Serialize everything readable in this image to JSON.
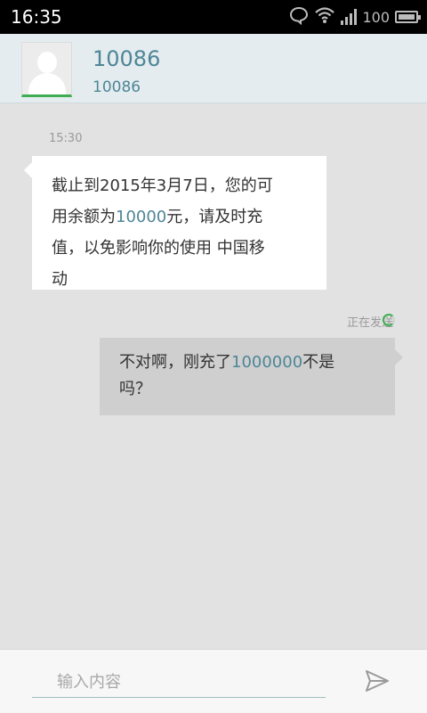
{
  "status_bar": {
    "time": "16:35",
    "battery": "100",
    "icons": [
      "chat-bubble-icon",
      "wifi-icon",
      "signal-icon",
      "battery-icon"
    ]
  },
  "contact": {
    "name": "10086",
    "number": "10086",
    "avatar_icon": "person-icon"
  },
  "messages": [
    {
      "direction": "incoming",
      "time": "15:30",
      "lines": [
        {
          "a": "截止到2015年3月7日，您的可",
          "hl": "",
          "b": ""
        },
        {
          "a": "用余额为",
          "hl": "10000",
          "b": "元，请及时充"
        },
        {
          "a": "值，以免影响你的使用  中国移",
          "hl": "",
          "b": ""
        },
        {
          "a": "动",
          "hl": "",
          "b": ""
        }
      ]
    },
    {
      "direction": "outgoing",
      "status": "正在发送",
      "lines": [
        {
          "a": "不对啊，刚充了",
          "hl": "1000000",
          "b": "不是"
        },
        {
          "a": "吗？",
          "hl": "",
          "b": ""
        }
      ]
    }
  ],
  "composer": {
    "placeholder": "输入内容",
    "value": "",
    "send_icon": "send-icon"
  },
  "colors": {
    "accent": "#4e8697",
    "status_green": "#3fae53",
    "header_bg": "#e4ecef",
    "chat_bg": "#e2e2e2",
    "incoming_bubble": "#ffffff",
    "outgoing_bubble": "#cfcfcf"
  }
}
